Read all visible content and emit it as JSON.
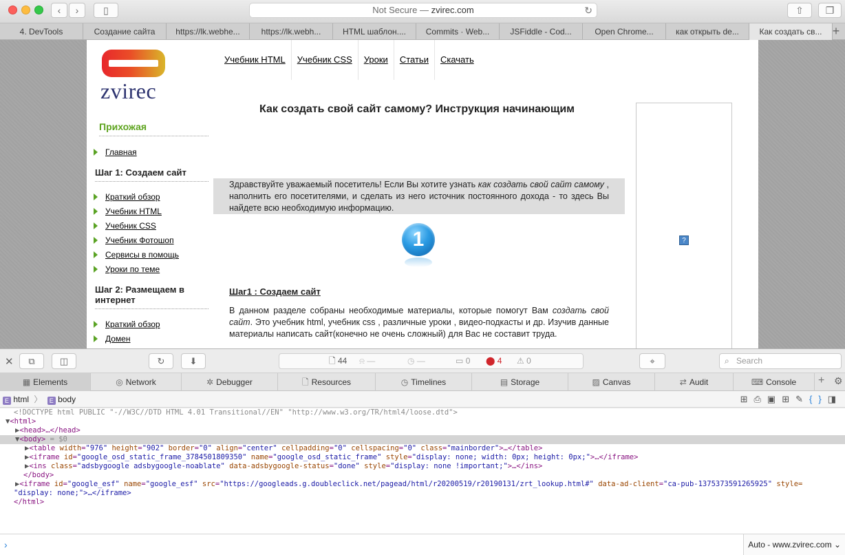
{
  "browser": {
    "address": {
      "not_secure": "Not Secure —",
      "domain": "zvirec.com"
    },
    "tabs": [
      "4. DevTools",
      "Создание сайта",
      "https://lk.webhe...",
      "https://lk.webh...",
      "HTML шаблон....",
      "Commits · Web...",
      "JSFiddle - Cod...",
      "Open Chrome...",
      "как открыть de...",
      "Как создать св..."
    ],
    "new_tab": "+"
  },
  "page": {
    "logo_text": "zvirec",
    "topnav": [
      "Учебник HTML",
      "Учебник CSS",
      "Уроки",
      "Статьи",
      "Скачать"
    ],
    "sidebar": {
      "section0": {
        "title": "Прихожая",
        "links": [
          "Главная"
        ]
      },
      "section1": {
        "title": "Шаг 1: Создаем сайт",
        "links": [
          "Краткий обзор",
          "Учебник HTML",
          "Учебник CSS",
          "Учебник Фотошоп",
          "Сервисы в помощь",
          "Уроки по теме"
        ]
      },
      "section2": {
        "title": "Шаг 2: Размещаем в интернет",
        "links": [
          "Краткий обзор",
          "Домен"
        ]
      }
    },
    "title": "Как создать свой сайт самому? Инструкция начинающим",
    "intro": {
      "part1": "Здравствуйте уважаемый посетитель! Если Вы хотите узнать ",
      "em": "как создать свой сайт самому",
      "part2": " , наполнить его посетителями, и сделать из него источник постоянного дохода - то здесь Вы найдете всю необходимую информацию."
    },
    "step_badge": "1",
    "step_heading": "Шаг1 : Создаем сайт",
    "step_text": {
      "part1": "В данном разделе собраны необходимые материалы, которые помогут Вам ",
      "em": "создать свой сайт",
      "part2": ". Это учебник html, учебник css , различные уроки , видео-подкасты и др. Изучив данные материалы написать сайт(конечно не очень сложный) для Вас не составит труда."
    },
    "ad_icon": "?"
  },
  "inspector": {
    "activity": {
      "resources": "44",
      "bell": "—",
      "clock": "—",
      "logs": "0",
      "errors": "4",
      "warnings": "0"
    },
    "search_placeholder": "Search",
    "tabs": [
      "Elements",
      "Network",
      "Debugger",
      "Resources",
      "Timelines",
      "Storage",
      "Canvas",
      "Audit",
      "Console"
    ],
    "breadcrumb": [
      "html",
      "body"
    ],
    "dom": {
      "doctype": "<!DOCTYPE html PUBLIC \"-//W3C//DTD HTML 4.01 Transitional//EN\" \"http://www.w3.org/TR/html4/loose.dtd\">",
      "html_open": "<html>",
      "head": "<head>…</head>",
      "body_open": "<body>",
      "body_var": " = $0",
      "table": {
        "tag": "table",
        "attrs": [
          [
            "width",
            "976"
          ],
          [
            "height",
            "902"
          ],
          [
            "border",
            "0"
          ],
          [
            "align",
            "center"
          ],
          [
            "cellpadding",
            "0"
          ],
          [
            "cellspacing",
            "0"
          ],
          [
            "class",
            "mainborder"
          ]
        ],
        "close": ">…</table>"
      },
      "iframe1": {
        "tag": "iframe",
        "attrs": [
          [
            "id",
            "google_osd_static_frame_3784501809350"
          ],
          [
            "name",
            "google_osd_static_frame"
          ],
          [
            "style",
            "display: none; width: 0px; height: 0px;"
          ]
        ],
        "close": ">…</iframe>"
      },
      "ins": {
        "tag": "ins",
        "attrs": [
          [
            "class",
            "adsbygoogle adsbygoogle-noablate"
          ],
          [
            "data-adsbygoogle-status",
            "done"
          ],
          [
            "style",
            "display: none !important;"
          ]
        ],
        "close": ">…</ins>"
      },
      "body_close": "</body>",
      "iframe2": {
        "tag": "iframe",
        "attrs": [
          [
            "id",
            "google_esf"
          ],
          [
            "name",
            "google_esf"
          ],
          [
            "src",
            "https://googleads.g.doubleclick.net/pagead/html/r20200519/r20190131/zrt_lookup.html#"
          ],
          [
            "data-ad-client",
            "ca-pub-1375373591265925"
          ]
        ],
        "trail_attr": "style=",
        "wrap": "\"display: none;\">…</iframe>"
      },
      "html_close": "</html>"
    },
    "console_context": "Auto - www.zvirec.com"
  }
}
